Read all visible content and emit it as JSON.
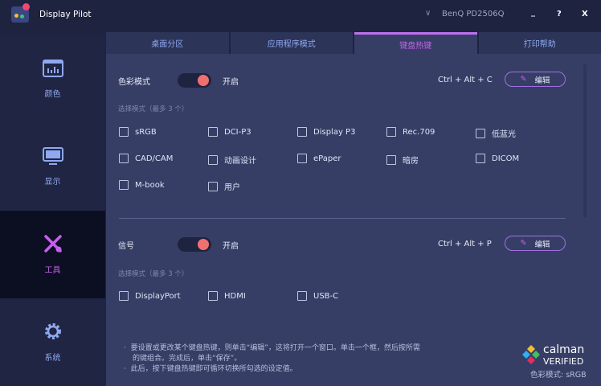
{
  "app": {
    "title": "Display Pilot",
    "monitor": "BenQ PD2506Q",
    "minimize": "_",
    "help": "?",
    "close": "X"
  },
  "sidebar": {
    "items": [
      {
        "label": "颜色",
        "icon": "bar-chart-icon"
      },
      {
        "label": "显示",
        "icon": "monitor-icon"
      },
      {
        "label": "工具",
        "icon": "tools-icon",
        "active": true
      },
      {
        "label": "系统",
        "icon": "gear-icon"
      }
    ]
  },
  "tabs": [
    {
      "label": "桌面分区"
    },
    {
      "label": "应用程序模式"
    },
    {
      "label": "键盘热键",
      "active": true
    },
    {
      "label": "打印帮助"
    }
  ],
  "color_mode": {
    "title": "色彩模式",
    "toggle_label": "开启",
    "toggle_on": true,
    "shortcut": "Ctrl + Alt + C",
    "edit": "编辑",
    "hint": "选择模式（最多 3 个）",
    "options": [
      "sRGB",
      "DCI-P3",
      "Display P3",
      "Rec.709",
      "低蓝光",
      "CAD/CAM",
      "动画设计",
      "ePaper",
      "暗房",
      "DICOM",
      "M-book",
      "用户"
    ]
  },
  "signal": {
    "title": "信号",
    "toggle_label": "开启",
    "toggle_on": true,
    "shortcut": "Ctrl + Alt + P",
    "edit": "编辑",
    "hint": "选择模式（最多 3 个）",
    "options": [
      "DisplayPort",
      "HDMI",
      "USB-C"
    ]
  },
  "notes": [
    "要设置或更改某个键盘热键，则单击“编辑”，这将打开一个窗口。单击一个框，然后按所需",
    "的键组合。完成后，单击“保存”。",
    "此后，按下键盘热键即可循环切换所勾选的设定值。"
  ],
  "calman": {
    "line1": "calman",
    "line2": "VERIFIED",
    "mode": "色彩模式: sRGB"
  },
  "colors": {
    "accent": "#c85ef0",
    "toggle": "#f07070",
    "panel": "#363e66"
  }
}
